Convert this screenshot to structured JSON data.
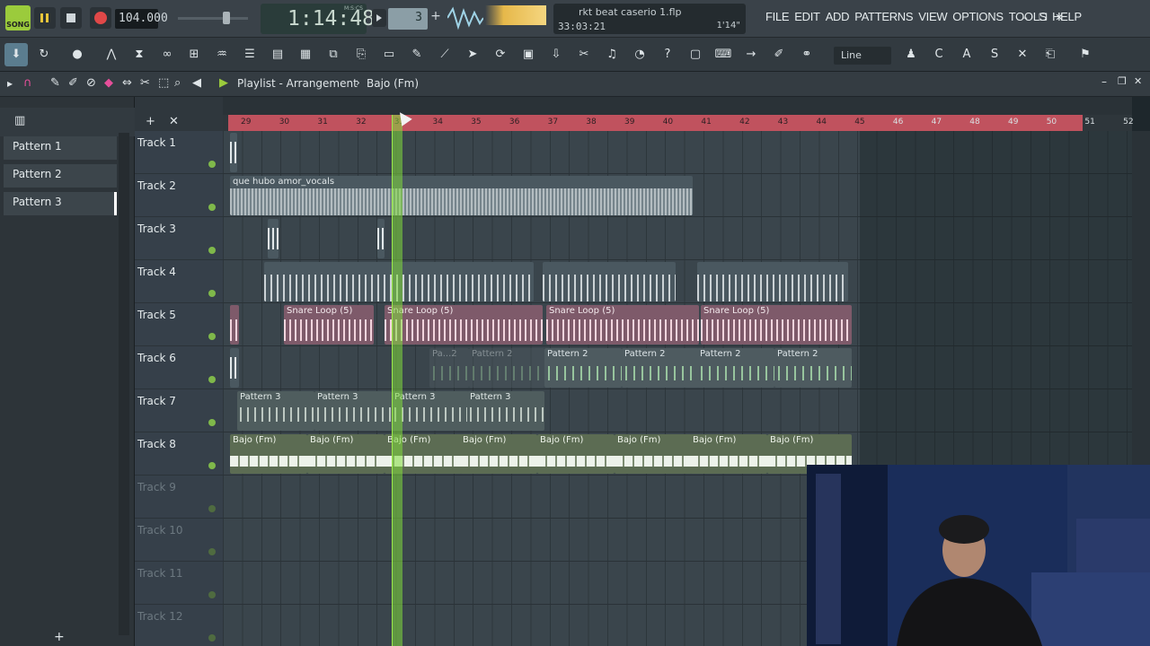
{
  "transport": {
    "mode_label": "SONG",
    "tempo": "104.000",
    "time_label": "M:S:CS",
    "time": "1:14:48",
    "pattern_number": "3"
  },
  "hint_bar": {
    "title": "rkt beat caserio 1.flp",
    "position": "33:03:21",
    "duration": "1'14\""
  },
  "menu": [
    "FILE",
    "EDIT",
    "ADD",
    "PATTERNS",
    "VIEW",
    "OPTIONS",
    "TOOLS",
    "HELP"
  ],
  "toolbar": {
    "snap_value": "Line"
  },
  "playlist": {
    "title": "Playlist - Arrangement",
    "current_pattern": "Bajo (Fm)"
  },
  "picker": {
    "items": [
      {
        "label": "Pattern 1"
      },
      {
        "label": "Pattern 2"
      },
      {
        "label": "Pattern 3",
        "selected": true
      }
    ]
  },
  "ruler": {
    "bars": [
      "29",
      "30",
      "31",
      "32",
      "33",
      "34",
      "35",
      "36",
      "37",
      "38",
      "39",
      "40",
      "41",
      "42",
      "43",
      "44",
      "45",
      "46",
      "47",
      "48",
      "49",
      "50",
      "51",
      "52"
    ]
  },
  "tracks": [
    {
      "label": "Track 1"
    },
    {
      "label": "Track 2"
    },
    {
      "label": "Track 3"
    },
    {
      "label": "Track 4"
    },
    {
      "label": "Track 5"
    },
    {
      "label": "Track 6"
    },
    {
      "label": "Track 7"
    },
    {
      "label": "Track 8"
    },
    {
      "label": "Track 9",
      "dim": true
    },
    {
      "label": "Track 10",
      "dim": true
    },
    {
      "label": "Track 11",
      "dim": true
    },
    {
      "label": "Track 12",
      "dim": true
    }
  ],
  "clips": {
    "track2": "que hubo amor_vocals",
    "snare": "Snare Loop (5)",
    "pattern2": "Pattern 2",
    "pattern2_short": "Pa...2",
    "pattern3": "Pattern 3",
    "bajo": "Bajo (Fm)"
  },
  "colors": {
    "ruler_active": "#c0525e",
    "playhead": "#9bea4a",
    "song_button": "#9bcb3c",
    "snare_clip": "#7e5a6a",
    "bajo_clip": "#5c6c53"
  }
}
